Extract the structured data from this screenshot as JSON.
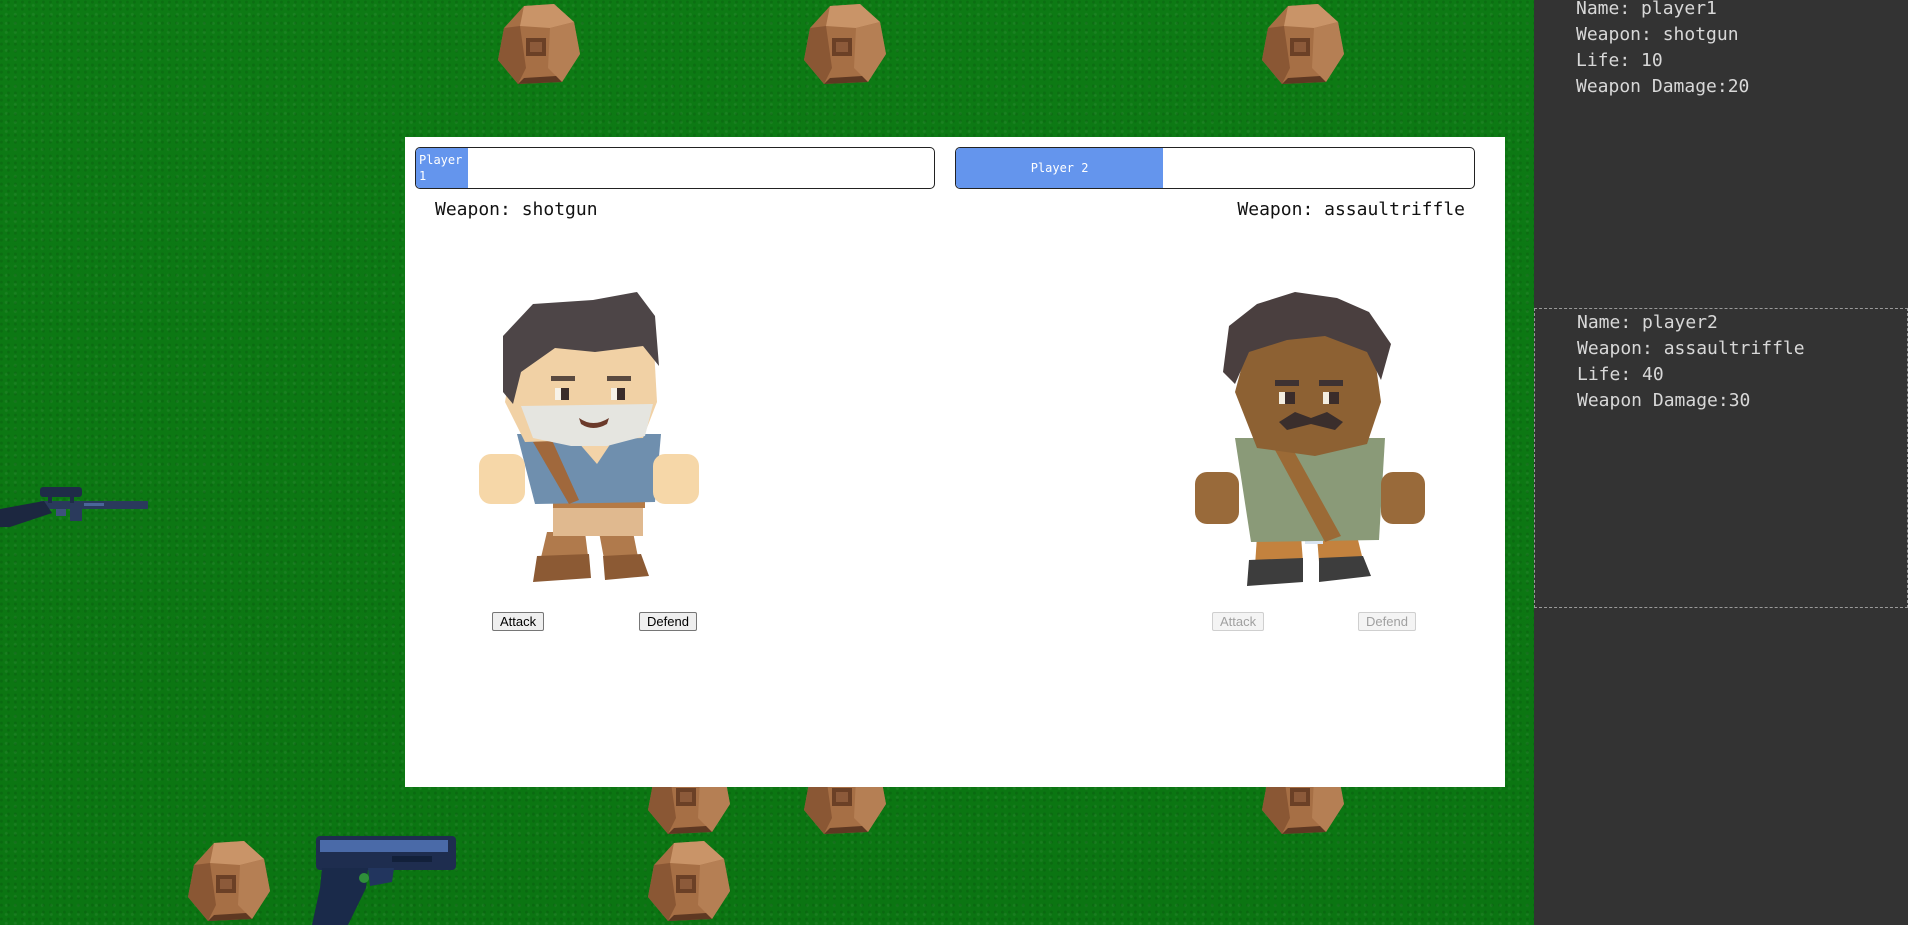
{
  "players": [
    {
      "health_label": "Player 1",
      "health_pct": 10,
      "weapon_label": "Weapon: shotgun",
      "attack_label": "Attack",
      "defend_label": "Defend",
      "active": true
    },
    {
      "health_label": "Player 2",
      "health_pct": 40,
      "weapon_label": "Weapon: assaultriffle",
      "attack_label": "Attack",
      "defend_label": "Defend",
      "active": false
    }
  ],
  "sidebar": {
    "player1": {
      "name": "Name: player1",
      "weapon": "Weapon: shotgun",
      "life": "Life: 10",
      "damage": "Weapon Damage:20"
    },
    "player2": {
      "name": "Name: player2",
      "weapon": "Weapon: assaultriffle",
      "life": "Life: 40",
      "damage": "Weapon Damage:30"
    }
  },
  "board_items": {
    "rocks": [
      "rock",
      "rock",
      "rock",
      "rock",
      "rock",
      "rock",
      "rock",
      "rock",
      "rock",
      "rock",
      "rock"
    ],
    "weapons": [
      "sniper-rifle-icon",
      "pistol-icon"
    ]
  },
  "colors": {
    "grass": "#0b7512",
    "health_fill": "#6495ed",
    "sidebar_bg": "#333333",
    "sidebar_text": "#d8d8d8"
  }
}
